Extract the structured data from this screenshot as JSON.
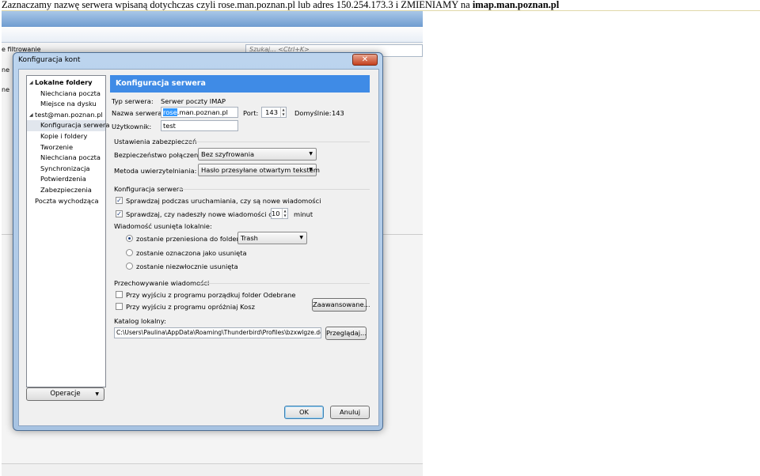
{
  "caption": {
    "text": "Zaznaczamy nazwę serwera wpisaną dotychczas czyli rose.man.poznan.pl lub adres 150.254.173.3 i ZMIENIAMY na",
    "bold": "imap.man.poznan.pl"
  },
  "background": {
    "filter_label": "e filtrowanie",
    "search_placeholder": "Szukaj... <Ctrl+K>",
    "side_text_1": "ne",
    "side_text_2": "ne"
  },
  "dialog": {
    "title": "Konfiguracja kont",
    "close_symbol": "✕",
    "tree": [
      {
        "label": "Lokalne foldery",
        "level": 0,
        "bold": true,
        "expander": "◢"
      },
      {
        "label": "Niechciana poczta",
        "level": 1
      },
      {
        "label": "Miejsce na dysku",
        "level": 1
      },
      {
        "label": "test@man.poznan.pl",
        "level": 0,
        "expander": "◢"
      },
      {
        "label": "Konfiguracja serwera",
        "level": 1,
        "selected": true
      },
      {
        "label": "Kopie i foldery",
        "level": 1
      },
      {
        "label": "Tworzenie",
        "level": 1
      },
      {
        "label": "Niechciana poczta",
        "level": 1
      },
      {
        "label": "Synchronizacja",
        "level": 1
      },
      {
        "label": "Potwierdzenia",
        "level": 1
      },
      {
        "label": "Zabezpieczenia",
        "level": 1
      },
      {
        "label": "Poczta wychodząca",
        "level": 0
      }
    ],
    "operations_button": "Operacje",
    "panel_title": "Konfiguracja serwera",
    "server_type_label": "Typ serwera:",
    "server_type_value": "Serwer poczty IMAP",
    "server_name_label": "Nazwa serwera:",
    "server_name_selected": "rose",
    "server_name_rest": ".man.poznan.pl",
    "port_label": "Port:",
    "port_value": "143",
    "default_label": "Domyślnie:",
    "default_value": "143",
    "user_label": "Użytkownik:",
    "user_value": "test",
    "security_group": "Ustawienia zabezpieczeń",
    "conn_security_label": "Bezpieczeństwo połączenia:",
    "conn_security_value": "Bez szyfrowania",
    "auth_label": "Metoda uwierzytelniania:",
    "auth_value": "Hasło przesyłane otwartym tekstem",
    "server_group": "Konfiguracja serwera",
    "check_startup": "Sprawdzaj podczas uruchamiania, czy są nowe wiadomości",
    "check_every": "Sprawdzaj, czy nadeszły nowe wiadomości co",
    "minutes_value": "10",
    "minutes_label": "minut",
    "deleted_label": "Wiadomość usunięta lokalnie:",
    "radio_move": "zostanie przeniesiona do folderu:",
    "trash_value": "Trash",
    "radio_mark": "zostanie oznaczona jako usunięta",
    "radio_delete": "zostanie niezwłocznie usunięta",
    "storage_group": "Przechowywanie wiadomości",
    "cleanup_inbox": "Przy wyjściu z programu porządkuj folder Odebrane",
    "empty_trash": "Przy wyjściu z programu opróżniaj Kosz",
    "advanced_button": "Zaawansowane...",
    "local_dir_label": "Katalog lokalny:",
    "local_dir_value": "C:\\Users\\Paulina\\AppData\\Roaming\\Thunderbird\\Profiles\\bzxwlgze.def",
    "browse_button": "Przeglądaj...",
    "ok_button": "OK",
    "cancel_button": "Anuluj"
  },
  "colors": {
    "header_blue": "#3f8be6",
    "selection_blue": "#3399ff",
    "close_red": "#c4401f"
  }
}
